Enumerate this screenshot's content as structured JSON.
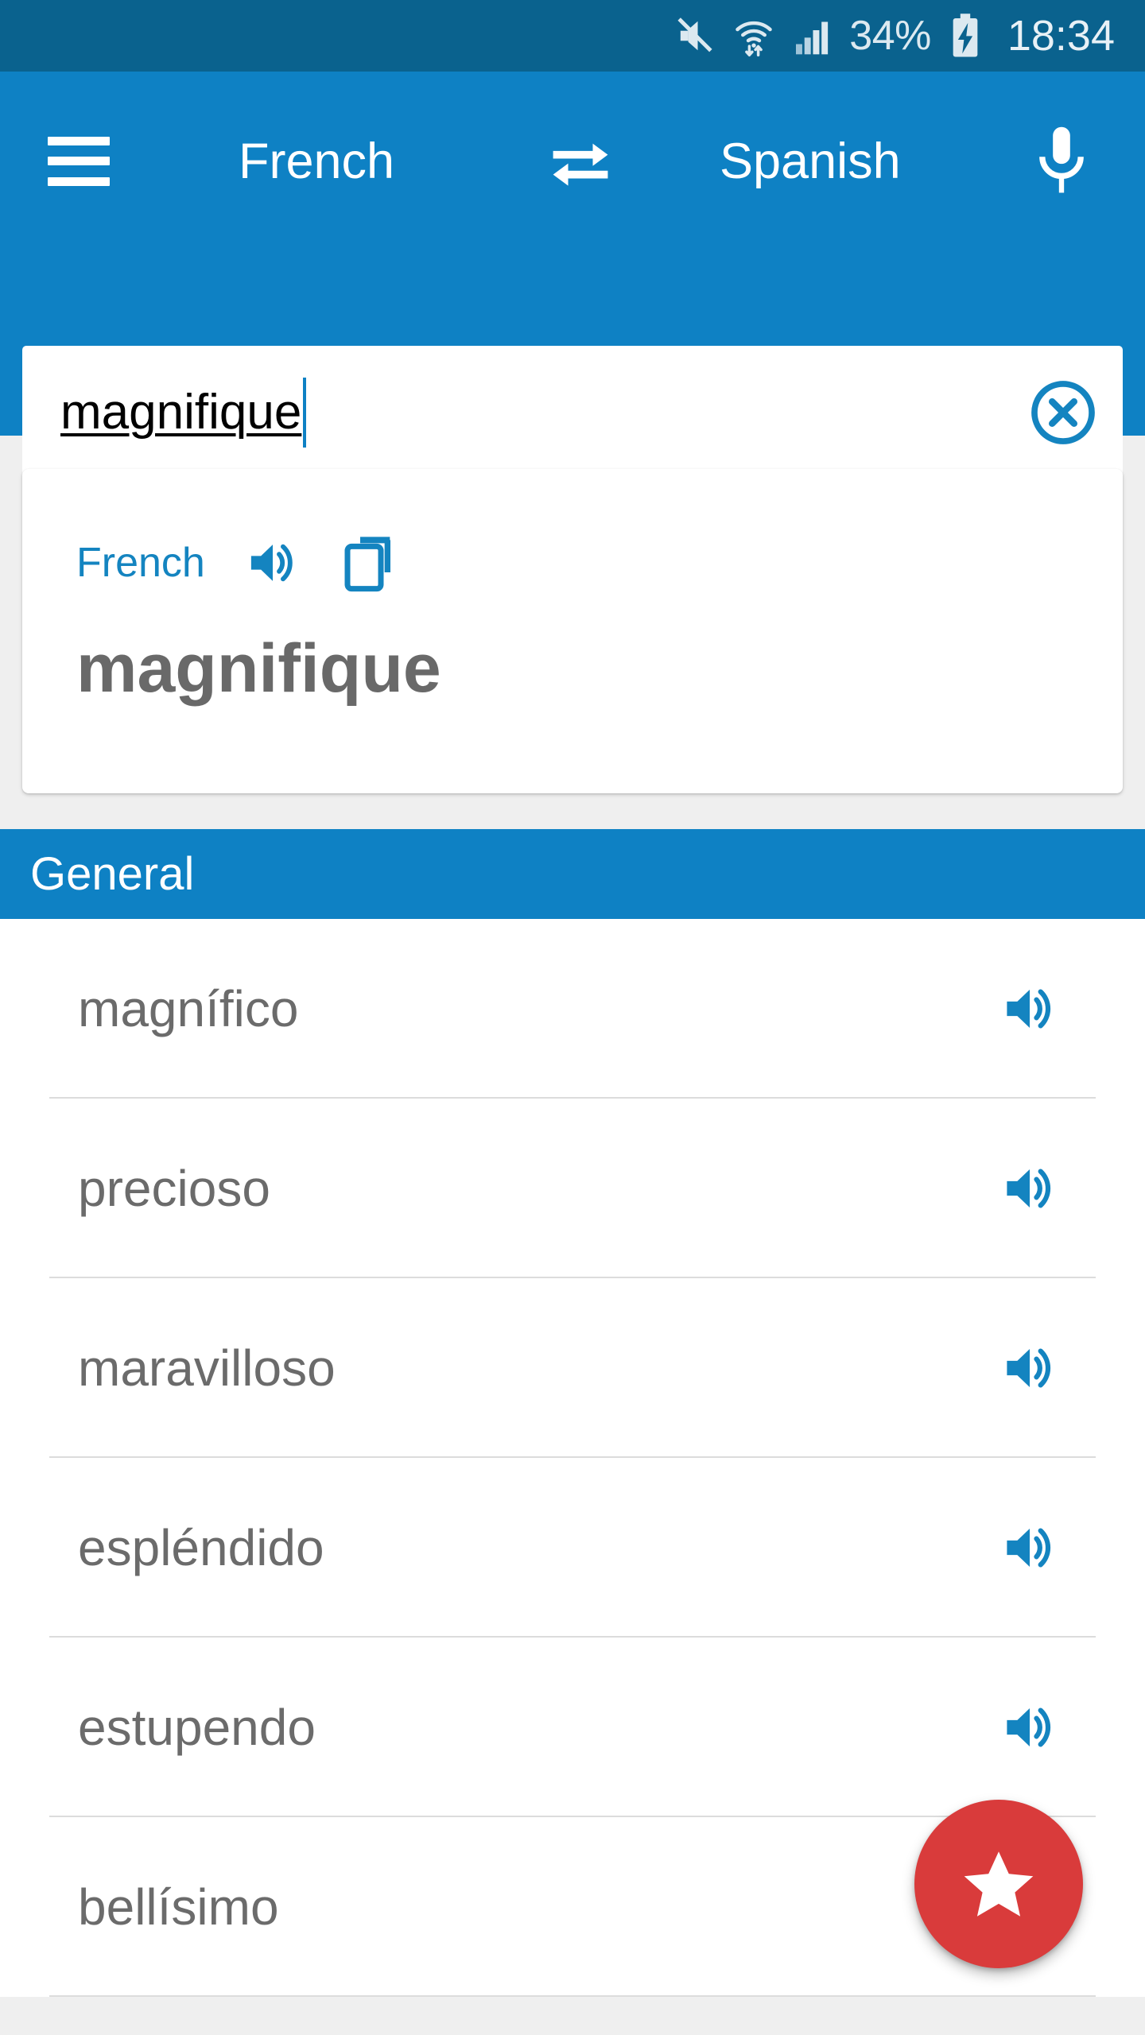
{
  "status_bar": {
    "icons": [
      "mute-icon",
      "wifi-icon",
      "signal-icon"
    ],
    "battery_percent": "34%",
    "battery_state": "charging",
    "time": "18:34"
  },
  "app_bar": {
    "menu_label": "menu",
    "source_language": "French",
    "swap_label": "swap-languages",
    "target_language": "Spanish",
    "mic_label": "voice-input"
  },
  "search": {
    "value": "magnifique",
    "placeholder": "",
    "clear_label": "clear"
  },
  "source_card": {
    "language": "French",
    "word": "magnifique",
    "speak_label": "listen",
    "copy_label": "copy"
  },
  "section": {
    "title": "General"
  },
  "results": [
    {
      "word": "magnífico",
      "speak_label": "listen"
    },
    {
      "word": "precioso",
      "speak_label": "listen"
    },
    {
      "word": "maravilloso",
      "speak_label": "listen"
    },
    {
      "word": "espléndido",
      "speak_label": "listen"
    },
    {
      "word": "estupendo",
      "speak_label": "listen"
    },
    {
      "word": "bellísimo",
      "speak_label": "listen"
    }
  ],
  "fab": {
    "label": "favorite",
    "icon": "star-icon",
    "color": "#d93b3b"
  },
  "colors": {
    "status_bar": "#0a628e",
    "app_bar": "#0e81c4",
    "accent": "#1484c0",
    "background": "#efefef",
    "text_primary": "#6b6b6b",
    "fab": "#d93b3b"
  }
}
